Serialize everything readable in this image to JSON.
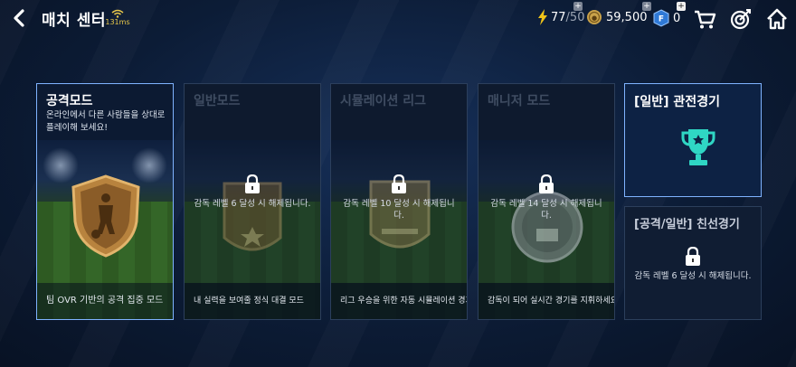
{
  "header": {
    "title": "매치 센터",
    "ping": "131ms",
    "energy_current": "77",
    "energy_max": "/50",
    "coins": "59,500",
    "fc_points": "0"
  },
  "modes": [
    {
      "name": "공격모드",
      "desc": "온라인에서 다른 사람들을 상대로 플레이해 보세요!",
      "footer": "팀 OVR 기반의 공격 집중 모드",
      "locked": false
    },
    {
      "name": "일반모드",
      "lock_msg": "감독 레벨 6 달성 시 해제됩니다.",
      "footer": "내 실력을 보여줄 정식 대결 모드",
      "locked": true
    },
    {
      "name": "시뮬레이션 리그",
      "lock_msg": "감독 레벨 10 달성 시 해제됩니다.",
      "footer": "리그 우승을 위한 자동 시뮬레이션 경기",
      "locked": true
    },
    {
      "name": "매니저 모드",
      "lock_msg": "감독 레벨 14 달성 시 해제됩니다.",
      "footer": "감독이 되어 실시간 경기를 지휘하세요",
      "locked": true
    }
  ],
  "spectate": {
    "name": "[일반] 관전경기"
  },
  "friendly": {
    "name": "[공격/일반] 친선경기",
    "lock_msg": "감독 레벨 6 달성 시 해제됩니다."
  },
  "colors": {
    "accent": "#7fb3ff",
    "trophy": "#2fd6c4",
    "energy": "#f0c419"
  }
}
